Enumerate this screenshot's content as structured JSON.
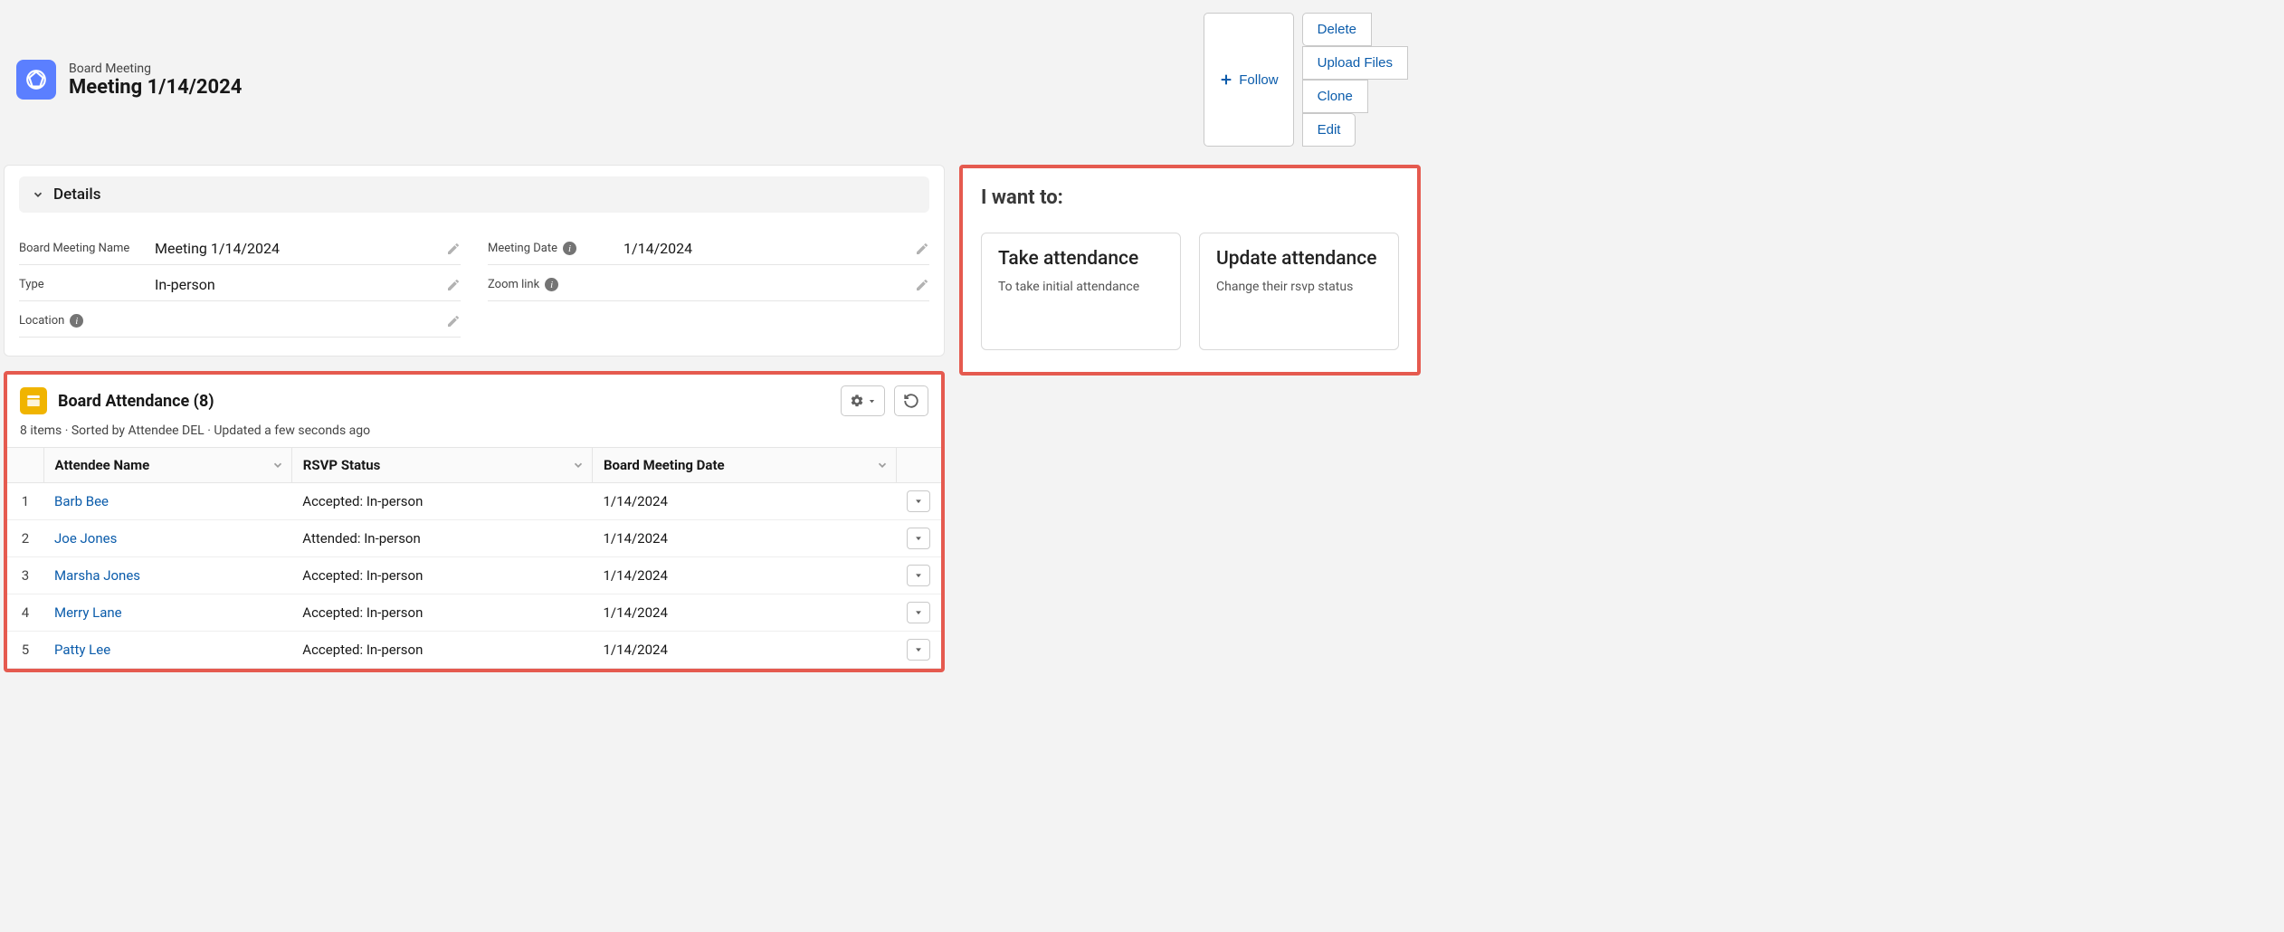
{
  "header": {
    "object_label": "Board Meeting",
    "page_title": "Meeting 1/14/2024",
    "actions": {
      "follow": "Follow",
      "delete": "Delete",
      "upload": "Upload Files",
      "clone": "Clone",
      "edit": "Edit"
    }
  },
  "details": {
    "section_title": "Details",
    "fields": {
      "name_label": "Board Meeting Name",
      "name_value": "Meeting 1/14/2024",
      "type_label": "Type",
      "type_value": "In-person",
      "location_label": "Location",
      "location_value": "",
      "date_label": "Meeting Date",
      "date_value": "1/14/2024",
      "zoom_label": "Zoom link",
      "zoom_value": ""
    }
  },
  "attendance": {
    "title": "Board Attendance (8)",
    "subtext": "8 items · Sorted by Attendee DEL · Updated a few seconds ago",
    "columns": {
      "name": "Attendee Name",
      "rsvp": "RSVP Status",
      "date": "Board Meeting Date"
    },
    "rows": [
      {
        "num": "1",
        "name": "Barb Bee",
        "rsvp": "Accepted: In-person",
        "date": "1/14/2024"
      },
      {
        "num": "2",
        "name": "Joe Jones",
        "rsvp": "Attended: In-person",
        "date": "1/14/2024"
      },
      {
        "num": "3",
        "name": "Marsha Jones",
        "rsvp": "Accepted: In-person",
        "date": "1/14/2024"
      },
      {
        "num": "4",
        "name": "Merry Lane",
        "rsvp": "Accepted: In-person",
        "date": "1/14/2024"
      },
      {
        "num": "5",
        "name": "Patty Lee",
        "rsvp": "Accepted: In-person",
        "date": "1/14/2024"
      }
    ]
  },
  "want": {
    "title": "I want to:",
    "tiles": [
      {
        "heading": "Take attendance",
        "sub": "To take initial attendance"
      },
      {
        "heading": "Update attendance",
        "sub": "Change their rsvp status"
      }
    ]
  }
}
